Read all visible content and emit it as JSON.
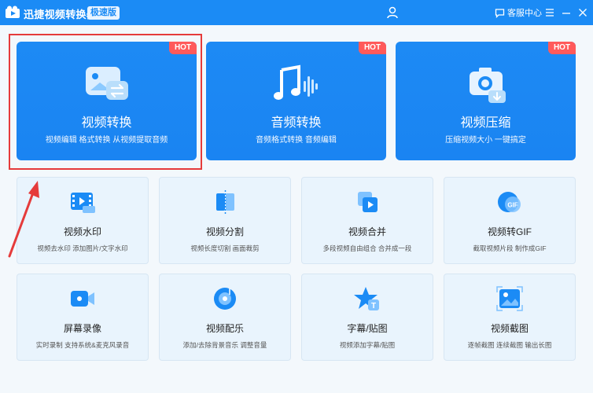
{
  "app": {
    "title": "迅捷视频转换器",
    "edition_badge": "极速版",
    "service_label": "客服中心"
  },
  "colors": {
    "primary": "#1b8bf5",
    "hot": "#ff5a5a",
    "highlight": "#e53b3b"
  },
  "hot_label": "HOT",
  "big_cards": [
    {
      "title": "视频转换",
      "desc": "视频编辑 格式转换 从视频提取音频",
      "icon": "video-convert-icon"
    },
    {
      "title": "音频转换",
      "desc": "音频格式转换 音频编辑",
      "icon": "music-wave-icon"
    },
    {
      "title": "视频压缩",
      "desc": "压缩视频大小 一键搞定",
      "icon": "camera-compress-icon"
    }
  ],
  "small_cards": [
    {
      "title": "视频水印",
      "desc": "视频去水印 添加图片/文字水印",
      "icon": "film-watermark-icon"
    },
    {
      "title": "视频分割",
      "desc": "视频长度切割 画面裁剪",
      "icon": "split-icon"
    },
    {
      "title": "视频合并",
      "desc": "多段视频自由组合 合并成一段",
      "icon": "merge-icon"
    },
    {
      "title": "视频转GIF",
      "desc": "截取视频片段 制作成GIF",
      "icon": "gif-icon"
    },
    {
      "title": "屏幕录像",
      "desc": "实时录制 支持系统&麦克风录音",
      "icon": "screen-record-icon"
    },
    {
      "title": "视频配乐",
      "desc": "添加/去除背景音乐 调整音量",
      "icon": "music-disc-icon"
    },
    {
      "title": "字幕/贴图",
      "desc": "视频添加字幕/贴图",
      "icon": "star-subtitle-icon"
    },
    {
      "title": "视频截图",
      "desc": "逐帧截图 连续截图 输出长图",
      "icon": "screenshot-icon"
    }
  ]
}
